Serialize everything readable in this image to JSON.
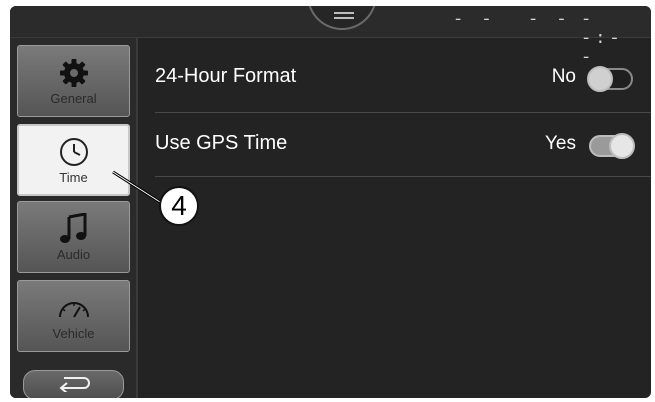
{
  "status_bar": {
    "left_time": "- -",
    "mid_time": "- -",
    "right_time": "- -:- -"
  },
  "sidebar": {
    "items": [
      {
        "label": "General",
        "icon": "gear-icon",
        "active": false
      },
      {
        "label": "Time",
        "icon": "clock-icon",
        "active": true
      },
      {
        "label": "Audio",
        "icon": "music-note-icon",
        "active": false
      },
      {
        "label": "Vehicle",
        "icon": "gauge-icon",
        "active": false
      }
    ],
    "back_icon": "back-arrow-icon"
  },
  "settings": {
    "rows": [
      {
        "label": "24-Hour Format",
        "value": "No",
        "toggle": "off"
      },
      {
        "label": "Use GPS Time",
        "value": "Yes",
        "toggle": "on"
      }
    ]
  },
  "callout": {
    "number": "4"
  }
}
